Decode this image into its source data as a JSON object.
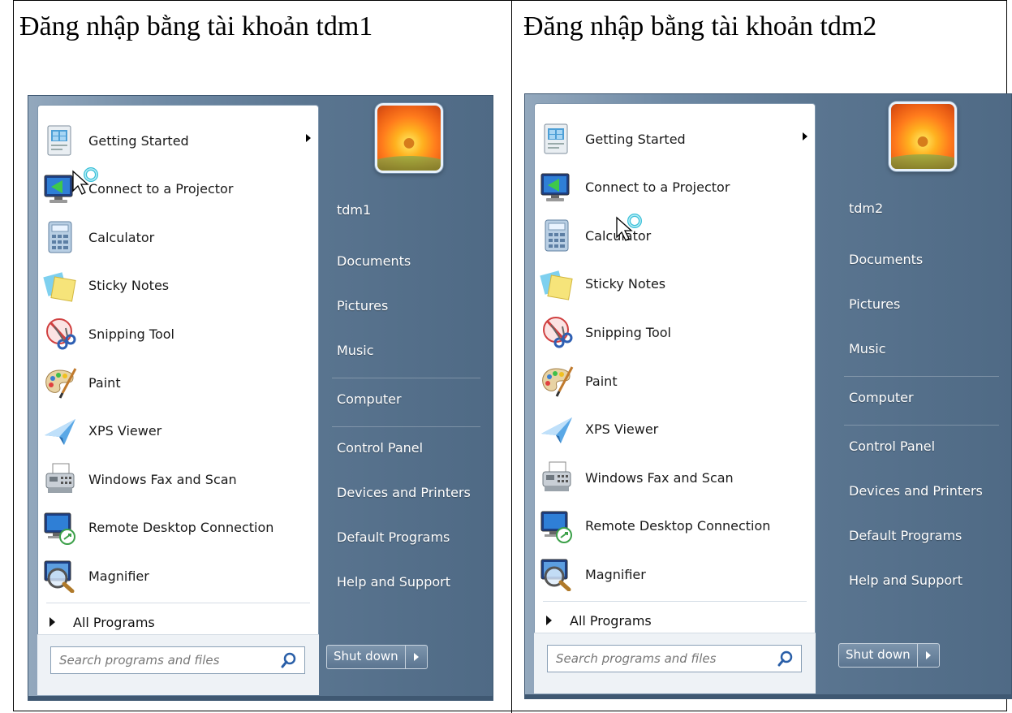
{
  "panels": [
    {
      "caption": "Đăng nhập bằng tài khoản tdm1",
      "username": "tdm1",
      "programs": [
        {
          "label": "Getting Started",
          "icon": "getting-started-icon",
          "submenu": true
        },
        {
          "label": "Connect to a Projector",
          "icon": "projector-icon"
        },
        {
          "label": "Calculator",
          "icon": "calculator-icon"
        },
        {
          "label": "Sticky Notes",
          "icon": "sticky-notes-icon"
        },
        {
          "label": "Snipping Tool",
          "icon": "snipping-tool-icon"
        },
        {
          "label": "Paint",
          "icon": "paint-palette-icon"
        },
        {
          "label": "XPS Viewer",
          "icon": "xps-viewer-icon"
        },
        {
          "label": "Windows Fax and Scan",
          "icon": "fax-scan-icon"
        },
        {
          "label": "Remote Desktop Connection",
          "icon": "remote-desktop-icon"
        },
        {
          "label": "Magnifier",
          "icon": "magnifier-icon"
        }
      ],
      "all_programs": "All Programs",
      "search_placeholder": "Search programs and files",
      "right_items": [
        "Documents",
        "Pictures",
        "Music",
        "Computer",
        "Control Panel",
        "Devices and Printers",
        "Default Programs",
        "Help and Support"
      ],
      "shutdown": "Shut down",
      "cursor_on": "Connect to a Projector"
    },
    {
      "caption": "Đăng nhập bằng tài khoản tdm2",
      "username": "tdm2",
      "programs": [
        {
          "label": "Getting Started",
          "icon": "getting-started-icon",
          "submenu": true
        },
        {
          "label": "Connect to a Projector",
          "icon": "projector-icon"
        },
        {
          "label": "Calculator",
          "icon": "calculator-icon"
        },
        {
          "label": "Sticky Notes",
          "icon": "sticky-notes-icon"
        },
        {
          "label": "Snipping Tool",
          "icon": "snipping-tool-icon"
        },
        {
          "label": "Paint",
          "icon": "paint-palette-icon"
        },
        {
          "label": "XPS Viewer",
          "icon": "xps-viewer-icon"
        },
        {
          "label": "Windows Fax and Scan",
          "icon": "fax-scan-icon"
        },
        {
          "label": "Remote Desktop Connection",
          "icon": "remote-desktop-icon"
        },
        {
          "label": "Magnifier",
          "icon": "magnifier-icon"
        }
      ],
      "all_programs": "All Programs",
      "search_placeholder": "Search programs and files",
      "right_items": [
        "Documents",
        "Pictures",
        "Music",
        "Computer",
        "Control Panel",
        "Devices and Printers",
        "Default Programs",
        "Help and Support"
      ],
      "shutdown": "Shut down",
      "cursor_on": "Calculator"
    }
  ]
}
